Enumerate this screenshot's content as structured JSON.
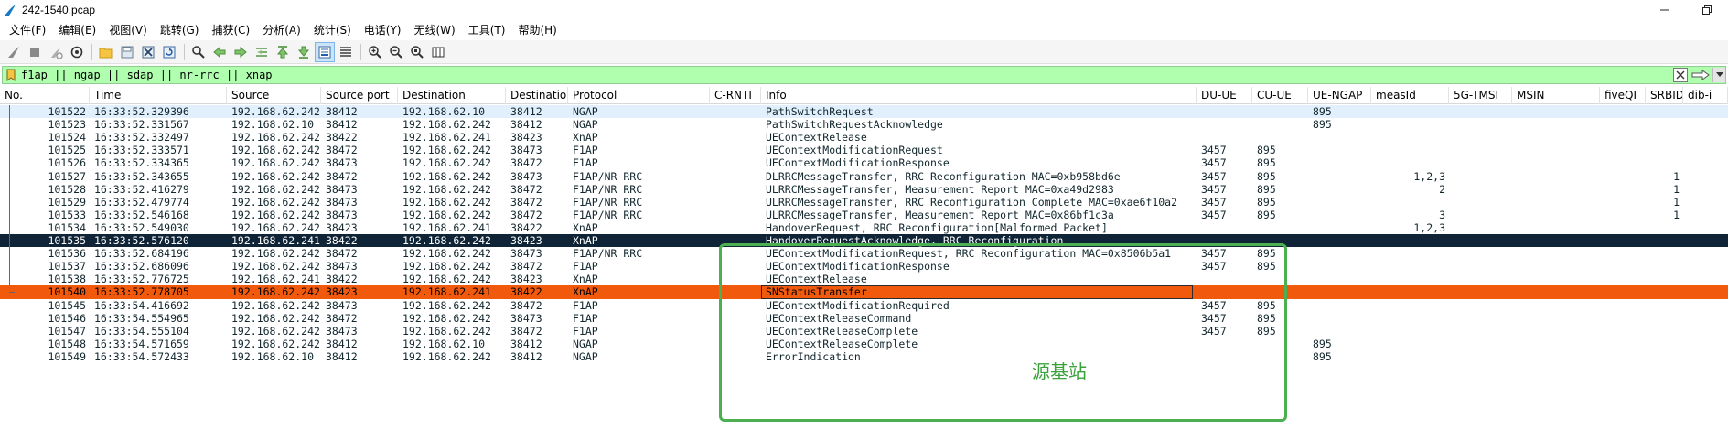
{
  "window": {
    "title": "242-1540.pcap"
  },
  "menu": [
    {
      "label": "文件(F)"
    },
    {
      "label": "编辑(E)"
    },
    {
      "label": "视图(V)"
    },
    {
      "label": "跳转(G)"
    },
    {
      "label": "捕获(C)"
    },
    {
      "label": "分析(A)"
    },
    {
      "label": "统计(S)"
    },
    {
      "label": "电话(Y)"
    },
    {
      "label": "无线(W)"
    },
    {
      "label": "工具(T)"
    },
    {
      "label": "帮助(H)"
    }
  ],
  "toolbar": {
    "icons": [
      "shark-fin-start-icon",
      "stop-square-icon",
      "restart-fin-icon",
      "capture-options-gear-icon",
      "open-folder-icon",
      "save-file-icon",
      "close-file-icon",
      "reload-icon",
      "find-packet-icon",
      "go-back-arrow-icon",
      "go-forward-arrow-icon",
      "go-to-packet-icon",
      "go-first-icon",
      "go-last-icon",
      "autoscroll-icon",
      "colorize-icon",
      "zoom-in-icon",
      "zoom-out-icon",
      "zoom-normal-icon",
      "resize-columns-icon"
    ]
  },
  "filter": {
    "value": "f1ap || ngap || sdap || nr-rrc || xnap"
  },
  "columns": [
    {
      "key": "no",
      "label": "No."
    },
    {
      "key": "time",
      "label": "Time"
    },
    {
      "key": "source",
      "label": "Source"
    },
    {
      "key": "sport",
      "label": "Source port"
    },
    {
      "key": "destination",
      "label": "Destination"
    },
    {
      "key": "dport",
      "label": "Destinatior"
    },
    {
      "key": "protocol",
      "label": "Protocol"
    },
    {
      "key": "crnti",
      "label": "C-RNTI"
    },
    {
      "key": "info",
      "label": "Info"
    },
    {
      "key": "duue",
      "label": "DU-UE"
    },
    {
      "key": "cuue",
      "label": "CU-UE"
    },
    {
      "key": "uengap",
      "label": "UE-NGAP"
    },
    {
      "key": "measid",
      "label": "measId"
    },
    {
      "key": "tmsi",
      "label": "5G-TMSI"
    },
    {
      "key": "msin",
      "label": "MSIN"
    },
    {
      "key": "fiveqi",
      "label": "fiveQI"
    },
    {
      "key": "srbid",
      "label": "SRBID"
    },
    {
      "key": "dibi",
      "label": "dib-i"
    }
  ],
  "packets": [
    {
      "no": "101522",
      "time": "16:33:52.329396",
      "source": "192.168.62.242",
      "sport": "38412",
      "destination": "192.168.62.10",
      "dport": "38412",
      "protocol": "NGAP",
      "crnti": "",
      "info": "PathSwitchRequest",
      "duue": "",
      "cuue": "",
      "uengap": "895",
      "measid": "",
      "tmsi": "",
      "msin": "",
      "fiveqi": "",
      "srbid": "",
      "dibi": "",
      "style": "bg-blue"
    },
    {
      "no": "101523",
      "time": "16:33:52.331567",
      "source": "192.168.62.10",
      "sport": "38412",
      "destination": "192.168.62.242",
      "dport": "38412",
      "protocol": "NGAP",
      "crnti": "",
      "info": "PathSwitchRequestAcknowledge",
      "duue": "",
      "cuue": "",
      "uengap": "895",
      "measid": "",
      "tmsi": "",
      "msin": "",
      "fiveqi": "",
      "srbid": "",
      "dibi": "",
      "style": "bg-white"
    },
    {
      "no": "101524",
      "time": "16:33:52.332497",
      "source": "192.168.62.242",
      "sport": "38422",
      "destination": "192.168.62.241",
      "dport": "38423",
      "protocol": "XnAP",
      "crnti": "",
      "info": "UEContextRelease",
      "duue": "",
      "cuue": "",
      "uengap": "",
      "measid": "",
      "tmsi": "",
      "msin": "",
      "fiveqi": "",
      "srbid": "",
      "dibi": "",
      "style": "bg-white"
    },
    {
      "no": "101525",
      "time": "16:33:52.333571",
      "source": "192.168.62.242",
      "sport": "38472",
      "destination": "192.168.62.242",
      "dport": "38473",
      "protocol": "F1AP",
      "crnti": "",
      "info": "UEContextModificationRequest",
      "duue": "3457",
      "cuue": "895",
      "uengap": "",
      "measid": "",
      "tmsi": "",
      "msin": "",
      "fiveqi": "",
      "srbid": "",
      "dibi": "",
      "style": "bg-white"
    },
    {
      "no": "101526",
      "time": "16:33:52.334365",
      "source": "192.168.62.242",
      "sport": "38473",
      "destination": "192.168.62.242",
      "dport": "38472",
      "protocol": "F1AP",
      "crnti": "",
      "info": "UEContextModificationResponse",
      "duue": "3457",
      "cuue": "895",
      "uengap": "",
      "measid": "",
      "tmsi": "",
      "msin": "",
      "fiveqi": "",
      "srbid": "",
      "dibi": "",
      "style": "bg-white"
    },
    {
      "no": "101527",
      "time": "16:33:52.343655",
      "source": "192.168.62.242",
      "sport": "38472",
      "destination": "192.168.62.242",
      "dport": "38473",
      "protocol": "F1AP/NR RRC",
      "crnti": "",
      "info": "DLRRCMessageTransfer, RRC Reconfiguration MAC=0xb958bd6e",
      "duue": "3457",
      "cuue": "895",
      "uengap": "",
      "measid": "1,2,3",
      "tmsi": "",
      "msin": "",
      "fiveqi": "",
      "srbid": "1",
      "dibi": "",
      "style": "bg-white"
    },
    {
      "no": "101528",
      "time": "16:33:52.416279",
      "source": "192.168.62.242",
      "sport": "38473",
      "destination": "192.168.62.242",
      "dport": "38472",
      "protocol": "F1AP/NR RRC",
      "crnti": "",
      "info": "ULRRCMessageTransfer, Measurement Report MAC=0xa49d2983",
      "duue": "3457",
      "cuue": "895",
      "uengap": "",
      "measid": "2",
      "tmsi": "",
      "msin": "",
      "fiveqi": "",
      "srbid": "1",
      "dibi": "",
      "style": "bg-white"
    },
    {
      "no": "101529",
      "time": "16:33:52.479774",
      "source": "192.168.62.242",
      "sport": "38473",
      "destination": "192.168.62.242",
      "dport": "38472",
      "protocol": "F1AP/NR RRC",
      "crnti": "",
      "info": "ULRRCMessageTransfer, RRC Reconfiguration Complete MAC=0xae6f10a2",
      "duue": "3457",
      "cuue": "895",
      "uengap": "",
      "measid": "",
      "tmsi": "",
      "msin": "",
      "fiveqi": "",
      "srbid": "1",
      "dibi": "",
      "style": "bg-white"
    },
    {
      "no": "101533",
      "time": "16:33:52.546168",
      "source": "192.168.62.242",
      "sport": "38473",
      "destination": "192.168.62.242",
      "dport": "38472",
      "protocol": "F1AP/NR RRC",
      "crnti": "",
      "info": "ULRRCMessageTransfer, Measurement Report MAC=0x86bf1c3a",
      "duue": "3457",
      "cuue": "895",
      "uengap": "",
      "measid": "3",
      "tmsi": "",
      "msin": "",
      "fiveqi": "",
      "srbid": "1",
      "dibi": "",
      "style": "bg-white"
    },
    {
      "no": "101534",
      "time": "16:33:52.549030",
      "source": "192.168.62.242",
      "sport": "38423",
      "destination": "192.168.62.241",
      "dport": "38422",
      "protocol": "XnAP",
      "crnti": "",
      "info": "HandoverRequest, RRC Reconfiguration[Malformed Packet]",
      "duue": "",
      "cuue": "",
      "uengap": "",
      "measid": "1,2,3",
      "tmsi": "",
      "msin": "",
      "fiveqi": "",
      "srbid": "",
      "dibi": "",
      "style": "bg-white"
    },
    {
      "no": "101535",
      "time": "16:33:52.576120",
      "source": "192.168.62.241",
      "sport": "38422",
      "destination": "192.168.62.242",
      "dport": "38423",
      "protocol": "XnAP",
      "crnti": "",
      "info": "HandoverRequestAcknowledge, RRC Reconfiguration",
      "duue": "",
      "cuue": "",
      "uengap": "",
      "measid": "",
      "tmsi": "",
      "msin": "",
      "fiveqi": "",
      "srbid": "",
      "dibi": "",
      "style": "sel-dark"
    },
    {
      "no": "101536",
      "time": "16:33:52.684196",
      "source": "192.168.62.242",
      "sport": "38472",
      "destination": "192.168.62.242",
      "dport": "38473",
      "protocol": "F1AP/NR RRC",
      "crnti": "",
      "info": "UEContextModificationRequest, RRC Reconfiguration MAC=0x8506b5a1",
      "duue": "3457",
      "cuue": "895",
      "uengap": "",
      "measid": "",
      "tmsi": "",
      "msin": "",
      "fiveqi": "",
      "srbid": "",
      "dibi": "",
      "style": "bg-white"
    },
    {
      "no": "101537",
      "time": "16:33:52.686096",
      "source": "192.168.62.242",
      "sport": "38473",
      "destination": "192.168.62.242",
      "dport": "38472",
      "protocol": "F1AP",
      "crnti": "",
      "info": "UEContextModificationResponse",
      "duue": "3457",
      "cuue": "895",
      "uengap": "",
      "measid": "",
      "tmsi": "",
      "msin": "",
      "fiveqi": "",
      "srbid": "",
      "dibi": "",
      "style": "bg-white"
    },
    {
      "no": "101538",
      "time": "16:33:52.776725",
      "source": "192.168.62.241",
      "sport": "38422",
      "destination": "192.168.62.242",
      "dport": "38423",
      "protocol": "XnAP",
      "crnti": "",
      "info": "UEContextRelease",
      "duue": "",
      "cuue": "",
      "uengap": "",
      "measid": "",
      "tmsi": "",
      "msin": "",
      "fiveqi": "",
      "srbid": "",
      "dibi": "",
      "style": "bg-white"
    },
    {
      "no": "101540",
      "time": "16:33:52.778705",
      "source": "192.168.62.242",
      "sport": "38423",
      "destination": "192.168.62.241",
      "dport": "38422",
      "protocol": "XnAP",
      "crnti": "",
      "info": "SNStatusTransfer",
      "duue": "",
      "cuue": "",
      "uengap": "",
      "measid": "",
      "tmsi": "",
      "msin": "",
      "fiveqi": "",
      "srbid": "",
      "dibi": "",
      "style": "sel-orange"
    },
    {
      "no": "101545",
      "time": "16:33:54.416692",
      "source": "192.168.62.242",
      "sport": "38473",
      "destination": "192.168.62.242",
      "dport": "38472",
      "protocol": "F1AP",
      "crnti": "",
      "info": "UEContextModificationRequired",
      "duue": "3457",
      "cuue": "895",
      "uengap": "",
      "measid": "",
      "tmsi": "",
      "msin": "",
      "fiveqi": "",
      "srbid": "",
      "dibi": "",
      "style": "bg-white"
    },
    {
      "no": "101546",
      "time": "16:33:54.554965",
      "source": "192.168.62.242",
      "sport": "38472",
      "destination": "192.168.62.242",
      "dport": "38473",
      "protocol": "F1AP",
      "crnti": "",
      "info": "UEContextReleaseCommand",
      "duue": "3457",
      "cuue": "895",
      "uengap": "",
      "measid": "",
      "tmsi": "",
      "msin": "",
      "fiveqi": "",
      "srbid": "",
      "dibi": "",
      "style": "bg-white"
    },
    {
      "no": "101547",
      "time": "16:33:54.555104",
      "source": "192.168.62.242",
      "sport": "38473",
      "destination": "192.168.62.242",
      "dport": "38472",
      "protocol": "F1AP",
      "crnti": "",
      "info": "UEContextReleaseComplete",
      "duue": "3457",
      "cuue": "895",
      "uengap": "",
      "measid": "",
      "tmsi": "",
      "msin": "",
      "fiveqi": "",
      "srbid": "",
      "dibi": "",
      "style": "bg-white"
    },
    {
      "no": "101548",
      "time": "16:33:54.571659",
      "source": "192.168.62.242",
      "sport": "38412",
      "destination": "192.168.62.10",
      "dport": "38412",
      "protocol": "NGAP",
      "crnti": "",
      "info": "UEContextReleaseComplete",
      "duue": "",
      "cuue": "",
      "uengap": "895",
      "measid": "",
      "tmsi": "",
      "msin": "",
      "fiveqi": "",
      "srbid": "",
      "dibi": "",
      "style": "bg-white"
    },
    {
      "no": "101549",
      "time": "16:33:54.572433",
      "source": "192.168.62.10",
      "sport": "38412",
      "destination": "192.168.62.242",
      "dport": "38412",
      "protocol": "NGAP",
      "crnti": "",
      "info": "ErrorIndication",
      "duue": "",
      "cuue": "",
      "uengap": "895",
      "measid": "",
      "tmsi": "",
      "msin": "",
      "fiveqi": "",
      "srbid": "",
      "dibi": "",
      "style": "bg-white"
    }
  ],
  "annotation": {
    "label": "源基站",
    "color": "#4caf50"
  }
}
